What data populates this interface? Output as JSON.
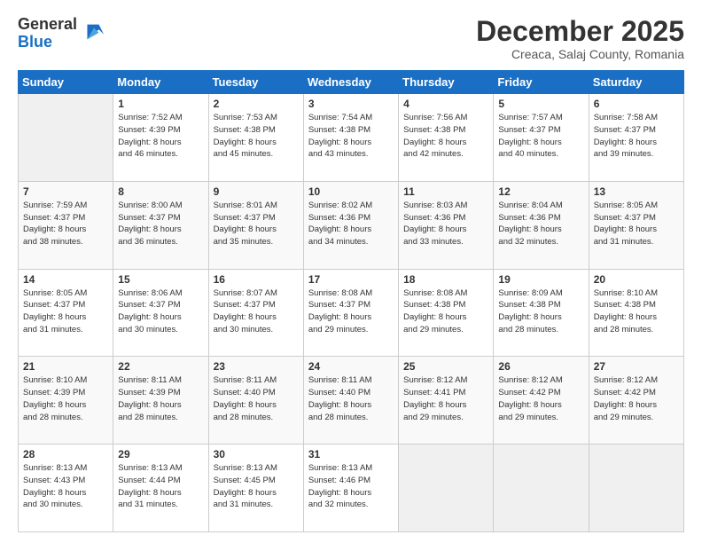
{
  "logo": {
    "general": "General",
    "blue": "Blue"
  },
  "header": {
    "month": "December 2025",
    "location": "Creaca, Salaj County, Romania"
  },
  "weekdays": [
    "Sunday",
    "Monday",
    "Tuesday",
    "Wednesday",
    "Thursday",
    "Friday",
    "Saturday"
  ],
  "weeks": [
    [
      {
        "day": "",
        "info": ""
      },
      {
        "day": "1",
        "info": "Sunrise: 7:52 AM\nSunset: 4:39 PM\nDaylight: 8 hours\nand 46 minutes."
      },
      {
        "day": "2",
        "info": "Sunrise: 7:53 AM\nSunset: 4:38 PM\nDaylight: 8 hours\nand 45 minutes."
      },
      {
        "day": "3",
        "info": "Sunrise: 7:54 AM\nSunset: 4:38 PM\nDaylight: 8 hours\nand 43 minutes."
      },
      {
        "day": "4",
        "info": "Sunrise: 7:56 AM\nSunset: 4:38 PM\nDaylight: 8 hours\nand 42 minutes."
      },
      {
        "day": "5",
        "info": "Sunrise: 7:57 AM\nSunset: 4:37 PM\nDaylight: 8 hours\nand 40 minutes."
      },
      {
        "day": "6",
        "info": "Sunrise: 7:58 AM\nSunset: 4:37 PM\nDaylight: 8 hours\nand 39 minutes."
      }
    ],
    [
      {
        "day": "7",
        "info": "Sunrise: 7:59 AM\nSunset: 4:37 PM\nDaylight: 8 hours\nand 38 minutes."
      },
      {
        "day": "8",
        "info": "Sunrise: 8:00 AM\nSunset: 4:37 PM\nDaylight: 8 hours\nand 36 minutes."
      },
      {
        "day": "9",
        "info": "Sunrise: 8:01 AM\nSunset: 4:37 PM\nDaylight: 8 hours\nand 35 minutes."
      },
      {
        "day": "10",
        "info": "Sunrise: 8:02 AM\nSunset: 4:36 PM\nDaylight: 8 hours\nand 34 minutes."
      },
      {
        "day": "11",
        "info": "Sunrise: 8:03 AM\nSunset: 4:36 PM\nDaylight: 8 hours\nand 33 minutes."
      },
      {
        "day": "12",
        "info": "Sunrise: 8:04 AM\nSunset: 4:36 PM\nDaylight: 8 hours\nand 32 minutes."
      },
      {
        "day": "13",
        "info": "Sunrise: 8:05 AM\nSunset: 4:37 PM\nDaylight: 8 hours\nand 31 minutes."
      }
    ],
    [
      {
        "day": "14",
        "info": "Sunrise: 8:05 AM\nSunset: 4:37 PM\nDaylight: 8 hours\nand 31 minutes."
      },
      {
        "day": "15",
        "info": "Sunrise: 8:06 AM\nSunset: 4:37 PM\nDaylight: 8 hours\nand 30 minutes."
      },
      {
        "day": "16",
        "info": "Sunrise: 8:07 AM\nSunset: 4:37 PM\nDaylight: 8 hours\nand 30 minutes."
      },
      {
        "day": "17",
        "info": "Sunrise: 8:08 AM\nSunset: 4:37 PM\nDaylight: 8 hours\nand 29 minutes."
      },
      {
        "day": "18",
        "info": "Sunrise: 8:08 AM\nSunset: 4:38 PM\nDaylight: 8 hours\nand 29 minutes."
      },
      {
        "day": "19",
        "info": "Sunrise: 8:09 AM\nSunset: 4:38 PM\nDaylight: 8 hours\nand 28 minutes."
      },
      {
        "day": "20",
        "info": "Sunrise: 8:10 AM\nSunset: 4:38 PM\nDaylight: 8 hours\nand 28 minutes."
      }
    ],
    [
      {
        "day": "21",
        "info": "Sunrise: 8:10 AM\nSunset: 4:39 PM\nDaylight: 8 hours\nand 28 minutes."
      },
      {
        "day": "22",
        "info": "Sunrise: 8:11 AM\nSunset: 4:39 PM\nDaylight: 8 hours\nand 28 minutes."
      },
      {
        "day": "23",
        "info": "Sunrise: 8:11 AM\nSunset: 4:40 PM\nDaylight: 8 hours\nand 28 minutes."
      },
      {
        "day": "24",
        "info": "Sunrise: 8:11 AM\nSunset: 4:40 PM\nDaylight: 8 hours\nand 28 minutes."
      },
      {
        "day": "25",
        "info": "Sunrise: 8:12 AM\nSunset: 4:41 PM\nDaylight: 8 hours\nand 29 minutes."
      },
      {
        "day": "26",
        "info": "Sunrise: 8:12 AM\nSunset: 4:42 PM\nDaylight: 8 hours\nand 29 minutes."
      },
      {
        "day": "27",
        "info": "Sunrise: 8:12 AM\nSunset: 4:42 PM\nDaylight: 8 hours\nand 29 minutes."
      }
    ],
    [
      {
        "day": "28",
        "info": "Sunrise: 8:13 AM\nSunset: 4:43 PM\nDaylight: 8 hours\nand 30 minutes."
      },
      {
        "day": "29",
        "info": "Sunrise: 8:13 AM\nSunset: 4:44 PM\nDaylight: 8 hours\nand 31 minutes."
      },
      {
        "day": "30",
        "info": "Sunrise: 8:13 AM\nSunset: 4:45 PM\nDaylight: 8 hours\nand 31 minutes."
      },
      {
        "day": "31",
        "info": "Sunrise: 8:13 AM\nSunset: 4:46 PM\nDaylight: 8 hours\nand 32 minutes."
      },
      {
        "day": "",
        "info": ""
      },
      {
        "day": "",
        "info": ""
      },
      {
        "day": "",
        "info": ""
      }
    ]
  ]
}
